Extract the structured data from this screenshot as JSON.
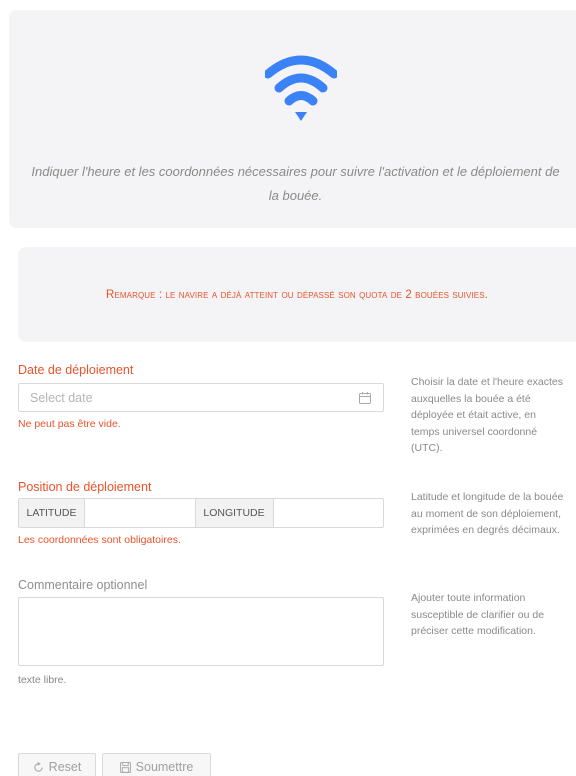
{
  "hero": {
    "icon": "wifi-icon",
    "description": "Indiquer l'heure et les coordonnées nécessaires pour suivre l'activation et le déploiement de la bouée."
  },
  "notice": {
    "text": "Remarque : le navire a déjà atteint ou dépassé son quota de 2 bouées suivies."
  },
  "date_field": {
    "label": "Date de déploiement",
    "placeholder": "Select date",
    "error": "Ne peut pas être vide.",
    "help": "Choisir la date et l'heure exactes auxquelles la bouée a été déployée et était active, en temps universel coordonné (UTC)."
  },
  "position_field": {
    "label": "Position de déploiement",
    "latitude_label": "LATITUDE",
    "longitude_label": "LONGITUDE",
    "latitude_value": "",
    "longitude_value": "",
    "error": "Les coordonnées sont obligatoires.",
    "help": "Latitude et longitude de la bouée au moment de son déploiement, exprimées en degrés décimaux."
  },
  "comment_field": {
    "label": "Commentaire optionnel",
    "value": "",
    "hint": "texte libre.",
    "help": "Ajouter toute information susceptible de clarifier ou de préciser cette modification."
  },
  "buttons": {
    "reset": "Reset",
    "submit": "Soumettre"
  },
  "colors": {
    "accent": "#3b82f6",
    "error": "#e8542b",
    "panel": "#f4f4f6"
  }
}
